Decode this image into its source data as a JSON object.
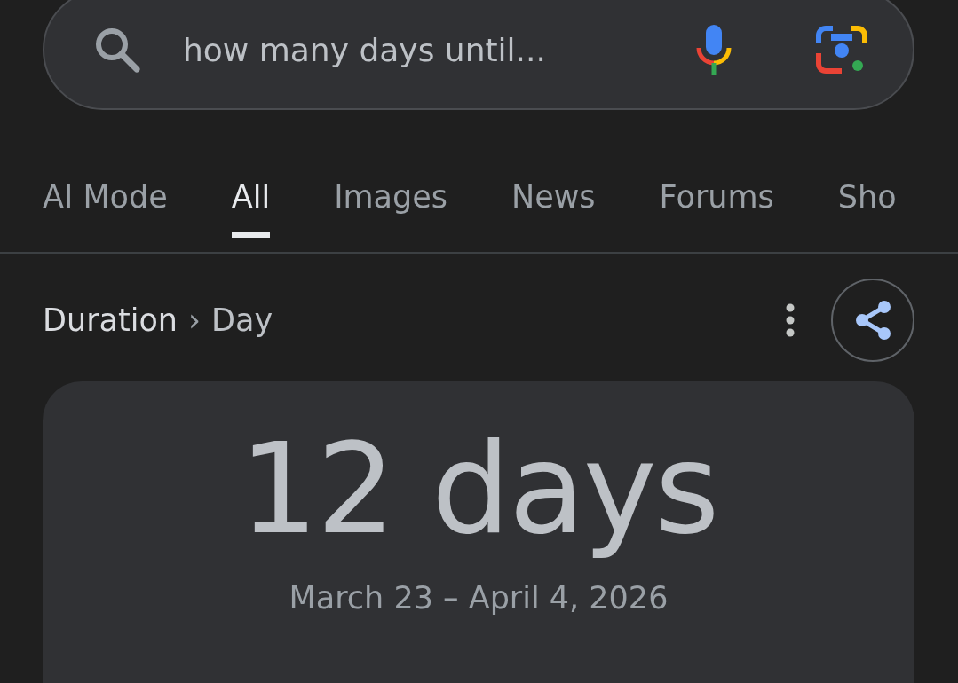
{
  "search": {
    "value": "how many days until..."
  },
  "tabs": [
    {
      "label": "AI Mode",
      "selected": false
    },
    {
      "label": "All",
      "selected": true
    },
    {
      "label": "Images",
      "selected": false
    },
    {
      "label": "News",
      "selected": false
    },
    {
      "label": "Forums",
      "selected": false
    },
    {
      "label": "Sho",
      "selected": false
    }
  ],
  "breadcrumb": {
    "parent": "Duration",
    "separator": "›",
    "current": "Day"
  },
  "result": {
    "value": "12 days",
    "range": "March 23 – April 4, 2026"
  }
}
